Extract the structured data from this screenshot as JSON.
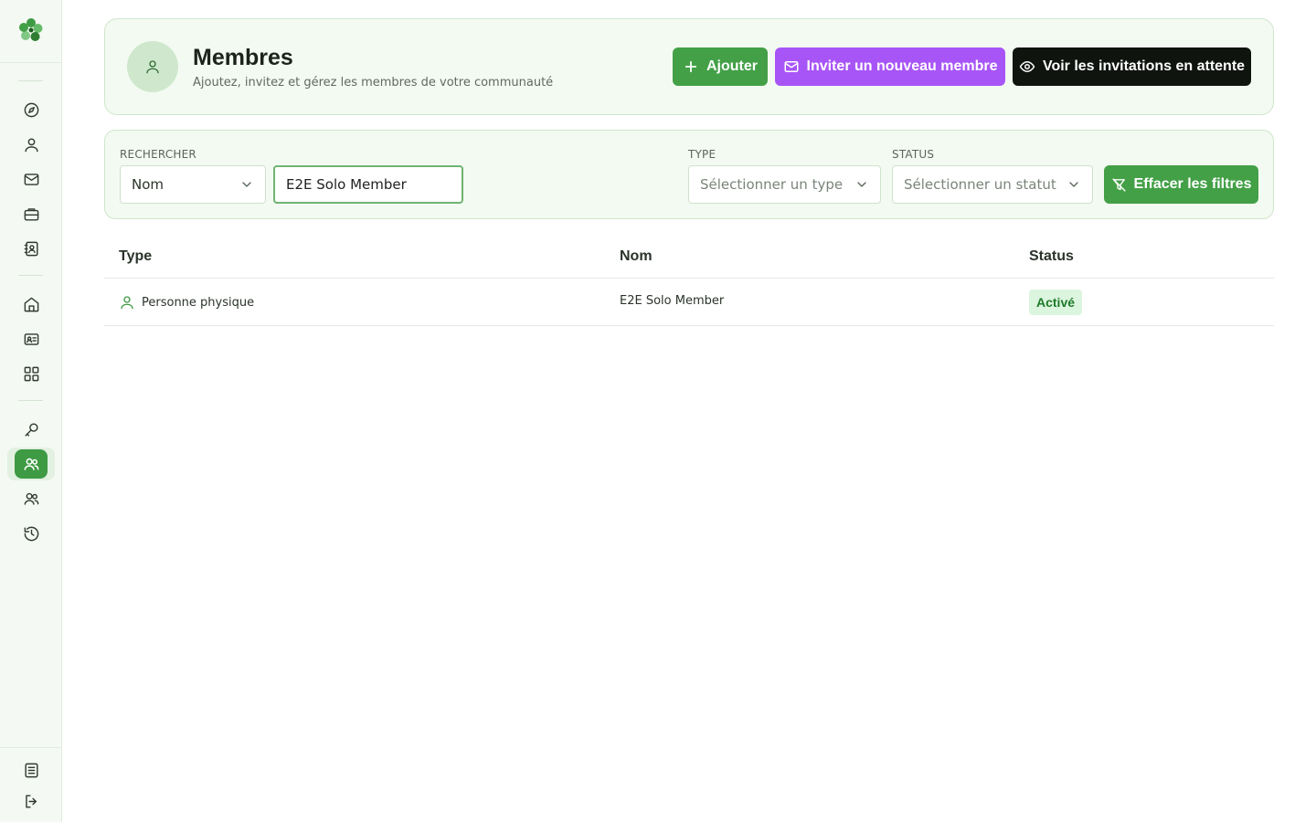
{
  "header": {
    "title": "Membres",
    "subtitle": "Ajoutez, invitez et gérez les membres de votre communauté",
    "add_label": "Ajouter",
    "invite_label": "Inviter un nouveau membre",
    "pending_label": "Voir les invitations en attente"
  },
  "filters": {
    "search_label": "RECHERCHER",
    "search_field": "Nom",
    "search_value": "E2E Solo Member",
    "type_label": "TYPE",
    "type_placeholder": "Sélectionner un type",
    "status_label": "STATUS",
    "status_placeholder": "Sélectionner un statut",
    "clear_label": "Effacer les filtres"
  },
  "table": {
    "columns": [
      "Type",
      "Nom",
      "Status"
    ],
    "rows": [
      {
        "type": "Personne physique",
        "name": "E2E Solo Member",
        "status": "Activé"
      }
    ]
  },
  "colors": {
    "primary": "#43a047",
    "invite": "#a855f7",
    "dark": "#0f140f",
    "badge_bg": "#dcf5de",
    "badge_text": "#1d7a2a"
  },
  "sidebar": {
    "icons": [
      "compass-icon",
      "user-icon",
      "mail-icon",
      "briefcase-icon",
      "contact-book-icon",
      "home-icon",
      "id-card-icon",
      "grid-icon",
      "key-icon",
      "members-icon",
      "users-icon",
      "history-icon",
      "document-icon",
      "logout-icon"
    ],
    "active": "members-icon"
  }
}
